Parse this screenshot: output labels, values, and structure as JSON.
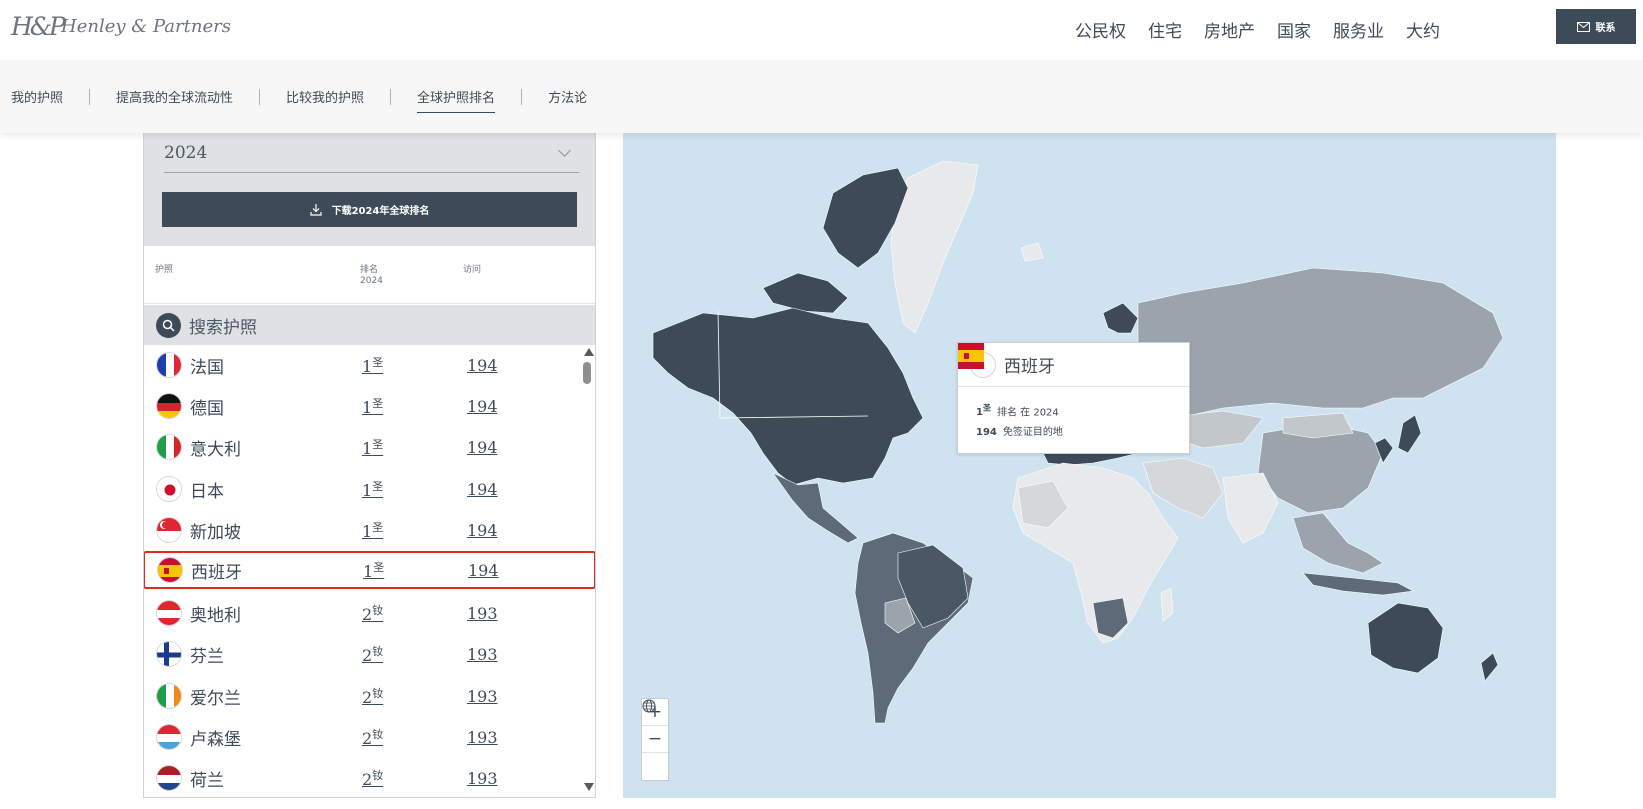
{
  "header": {
    "logo_mark": "H&P",
    "logo_text": "Henley & Partners",
    "nav": [
      "公民权",
      "住宅",
      "房地产",
      "国家",
      "服务业",
      "大约"
    ],
    "contact_label": "联系"
  },
  "subnav": {
    "items": [
      "我的护照",
      "提高我的全球流动性",
      "比较我的护照",
      "全球护照排名",
      "方法论"
    ],
    "active": "全球护照排名"
  },
  "panel": {
    "year": "2024",
    "download_label": "下载2024年全球排名",
    "col_passport": "护照",
    "col_rank": "排名",
    "col_rank_year": "2024",
    "col_visits": "访问",
    "search_placeholder": "搜索护照",
    "rows": [
      {
        "name": "法国",
        "rank": "1",
        "rank_suffix": "圣",
        "visits": "194",
        "flag": "france"
      },
      {
        "name": "德国",
        "rank": "1",
        "rank_suffix": "圣",
        "visits": "194",
        "flag": "germany"
      },
      {
        "name": "意大利",
        "rank": "1",
        "rank_suffix": "圣",
        "visits": "194",
        "flag": "italy"
      },
      {
        "name": "日本",
        "rank": "1",
        "rank_suffix": "圣",
        "visits": "194",
        "flag": "japan"
      },
      {
        "name": "新加坡",
        "rank": "1",
        "rank_suffix": "圣",
        "visits": "194",
        "flag": "singapore"
      },
      {
        "name": "西班牙",
        "rank": "1",
        "rank_suffix": "圣",
        "visits": "194",
        "flag": "spain",
        "selected": true
      },
      {
        "name": "奥地利",
        "rank": "2",
        "rank_suffix": "钕",
        "visits": "193",
        "flag": "austria"
      },
      {
        "name": "芬兰",
        "rank": "2",
        "rank_suffix": "钕",
        "visits": "193",
        "flag": "finland"
      },
      {
        "name": "爱尔兰",
        "rank": "2",
        "rank_suffix": "钕",
        "visits": "193",
        "flag": "ireland"
      },
      {
        "name": "卢森堡",
        "rank": "2",
        "rank_suffix": "钕",
        "visits": "193",
        "flag": "luxembourg"
      },
      {
        "name": "荷兰",
        "rank": "2",
        "rank_suffix": "钕",
        "visits": "193",
        "flag": "netherlands"
      }
    ]
  },
  "map": {
    "tooltip": {
      "country": "西班牙",
      "rank": "1",
      "rank_suffix": "圣",
      "rank_text": "排名 在 2024",
      "visits": "194",
      "visits_text": "免签证目的地"
    },
    "zoom_in": "+",
    "zoom_out": "−",
    "colors": {
      "ocean": "#cfe2ef",
      "darkest": "#3d4b59",
      "dark": "#5d6a77",
      "medium": "#9ba3ac",
      "light": "#d5d8db",
      "lightest": "#e8e9ea"
    }
  },
  "icons": [
    "mail-icon",
    "download-icon",
    "search-icon",
    "chevron-down-icon",
    "globe-icon"
  ]
}
